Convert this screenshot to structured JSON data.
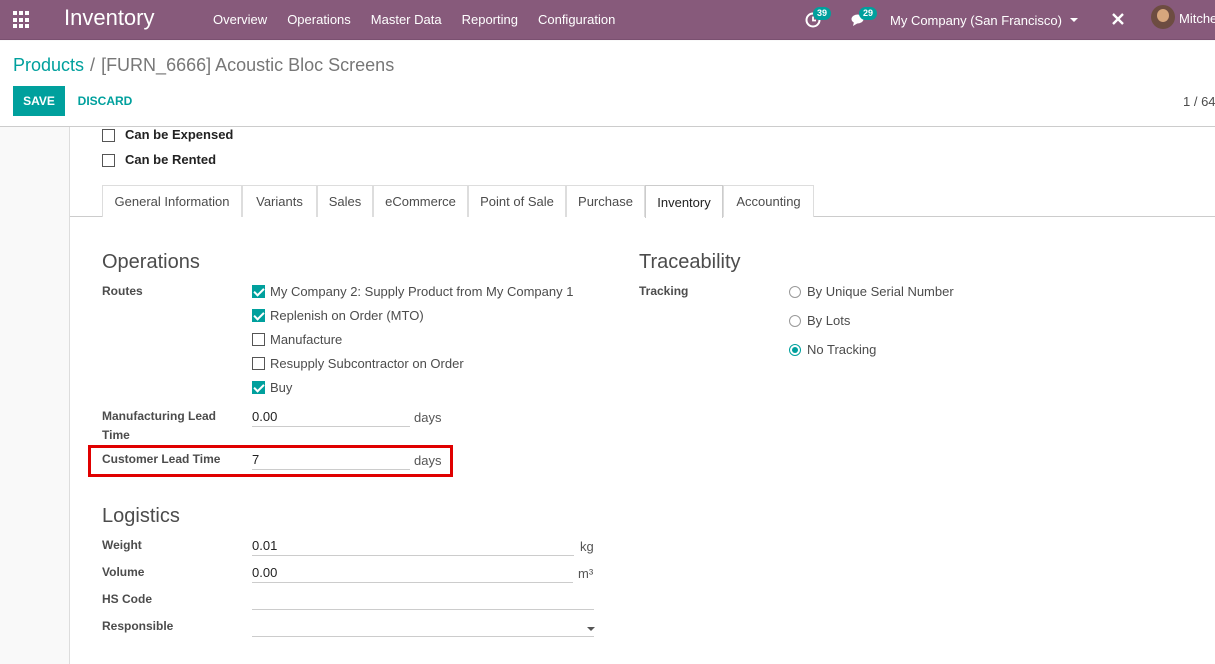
{
  "navbar": {
    "app_title": "Inventory",
    "menu": [
      "Overview",
      "Operations",
      "Master Data",
      "Reporting",
      "Configuration"
    ],
    "activity_count": "39",
    "message_count": "29",
    "company": "My Company (San Francisco)",
    "user": "Mitche"
  },
  "breadcrumb": {
    "parent": "Products",
    "separator": "/",
    "current": "[FURN_6666] Acoustic Bloc Screens"
  },
  "actions": {
    "save": "SAVE",
    "discard": "DISCARD"
  },
  "pager": "1 / 64",
  "top_flags": [
    {
      "label": "Can be Expensed",
      "checked": false
    },
    {
      "label": "Can be Rented",
      "checked": false
    }
  ],
  "tabs": [
    "General Information",
    "Variants",
    "Sales",
    "eCommerce",
    "Point of Sale",
    "Purchase",
    "Inventory",
    "Accounting"
  ],
  "active_tab": "Inventory",
  "operations": {
    "title": "Operations",
    "routes_label": "Routes",
    "routes": [
      {
        "label": "My Company 2: Supply Product from My Company 1",
        "checked": true
      },
      {
        "label": "Replenish on Order (MTO)",
        "checked": true
      },
      {
        "label": "Manufacture",
        "checked": false
      },
      {
        "label": "Resupply Subcontractor on Order",
        "checked": false
      },
      {
        "label": "Buy",
        "checked": true
      }
    ],
    "manufacturing_lead_time_label": "Manufacturing Lead Time",
    "manufacturing_lead_time": "0.00",
    "customer_lead_time_label": "Customer Lead Time",
    "customer_lead_time": "7",
    "days_unit": "days"
  },
  "traceability": {
    "title": "Traceability",
    "tracking_label": "Tracking",
    "options": [
      {
        "label": "By Unique Serial Number",
        "selected": false
      },
      {
        "label": "By Lots",
        "selected": false
      },
      {
        "label": "No Tracking",
        "selected": true
      }
    ]
  },
  "logistics": {
    "title": "Logistics",
    "weight_label": "Weight",
    "weight": "0.01",
    "weight_unit": "kg",
    "volume_label": "Volume",
    "volume": "0.00",
    "volume_unit": "m³",
    "hs_code_label": "HS Code",
    "hs_code": "",
    "responsible_label": "Responsible",
    "responsible": ""
  },
  "colors": {
    "navbar": "#875a7b",
    "accent": "#00a09d",
    "highlight": "#e00000"
  }
}
